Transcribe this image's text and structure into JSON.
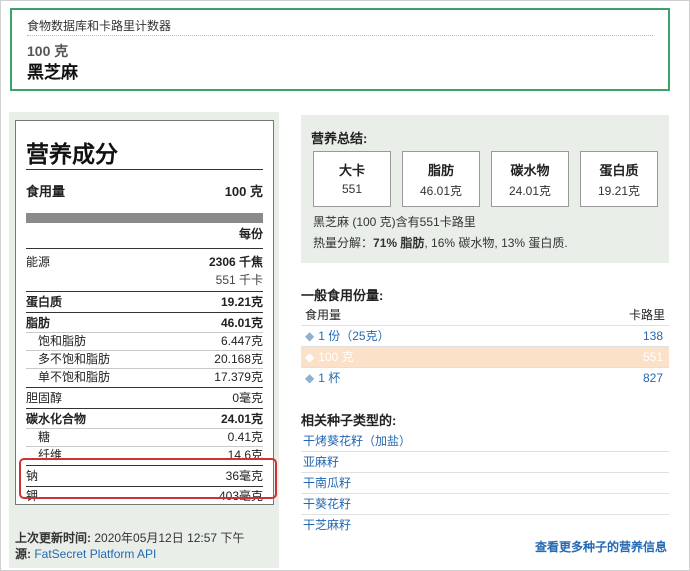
{
  "header": {
    "breadcrumb": "食物数据库和卡路里计数器",
    "serving": "100 克",
    "food_name": "黑芝麻"
  },
  "nutrition": {
    "title": "营养成分",
    "serving_label": "食用量",
    "serving_value": "100 克",
    "per_label": "每份",
    "energy_label": "能源",
    "energy_kj": "2306 千焦",
    "energy_kcal": "551 千卡",
    "protein_label": "蛋白质",
    "protein_value": "19.21克",
    "fat_label": "脂肪",
    "fat_value": "46.01克",
    "sat_fat_label": "饱和脂肪",
    "sat_fat_value": "6.447克",
    "poly_fat_label": "多不饱和脂肪",
    "poly_fat_value": "20.168克",
    "mono_fat_label": "单不饱和脂肪",
    "mono_fat_value": "17.379克",
    "cholesterol_label": "胆固醇",
    "cholesterol_value": "0毫克",
    "carb_label": "碳水化合物",
    "carb_value": "24.01克",
    "sugar_label": "糖",
    "sugar_value": "0.41克",
    "fiber_label": "纤维",
    "fiber_value": "14.6克",
    "sodium_label": "钠",
    "sodium_value": "36毫克",
    "potassium_label": "钾",
    "potassium_value": "403毫克",
    "updated_label": "上次更新时间:",
    "updated_value": "2020年05月12日 12:57 下午",
    "source_label": "源:",
    "source_link": "FatSecret Platform API"
  },
  "summary": {
    "title": "营养总结:",
    "boxes": [
      {
        "label": "大卡",
        "value": "551"
      },
      {
        "label": "脂肪",
        "value": "46.01克"
      },
      {
        "label": "碳水物",
        "value": "24.01克"
      },
      {
        "label": "蛋白质",
        "value": "19.21克"
      }
    ],
    "line1": "黑芝麻 (100 克)含有551卡路里",
    "line2_prefix": "热量分解：",
    "line2_bold": "71% 脂肪",
    "line2_rest": ", 16% 碳水物, 13% 蛋白质."
  },
  "common_servings": {
    "title": "一般食用份量:",
    "col_serving": "食用量",
    "col_calories": "卡路里",
    "rows": [
      {
        "label": "1 份（25克）",
        "value": "138",
        "selected": false
      },
      {
        "label": "100 克",
        "value": "551",
        "selected": true
      },
      {
        "label": "1 杯",
        "value": "827",
        "selected": false
      }
    ]
  },
  "related": {
    "title": "相关种子类型的:",
    "items": [
      "干烤葵花籽（加盐）",
      "亚麻籽",
      "干南瓜籽",
      "干葵花籽",
      "干芝麻籽"
    ],
    "more": "查看更多种子的营养信息"
  },
  "colors": {
    "accent_green": "#3aa36a",
    "link_blue": "#2469b3",
    "highlight_red": "#cc3333",
    "selected_row": "#fbe1c7"
  }
}
